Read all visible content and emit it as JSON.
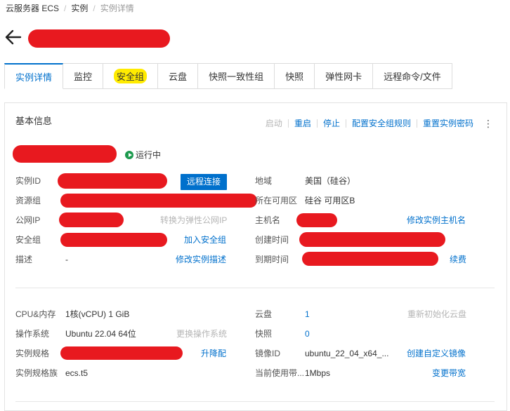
{
  "breadcrumb": {
    "items": [
      "云服务器 ECS",
      "实例",
      "实例详情"
    ],
    "separator": "/"
  },
  "tabs": [
    {
      "label": "实例详情",
      "active": true
    },
    {
      "label": "监控"
    },
    {
      "label": "安全组",
      "highlighted": true
    },
    {
      "label": "云盘"
    },
    {
      "label": "快照一致性组"
    },
    {
      "label": "快照"
    },
    {
      "label": "弹性网卡"
    },
    {
      "label": "远程命令/文件"
    }
  ],
  "basic_info": {
    "title": "基本信息",
    "actions": {
      "start": "启动",
      "restart": "重启",
      "stop": "停止",
      "config_sg_rules": "配置安全组规则",
      "reset_password": "重置实例密码",
      "more": "⋮"
    },
    "status": "运行中",
    "remote_connect": "远程连接",
    "fields": {
      "instance_id_label": "实例ID",
      "resource_group_label": "资源组",
      "public_ip_label": "公网IP",
      "convert_eip": "转换为弹性公网IP",
      "security_group_label": "安全组",
      "join_sg": "加入安全组",
      "description_label": "描述",
      "description_value": "-",
      "modify_description": "修改实例描述",
      "region_label": "地域",
      "region_value": "美国（硅谷）",
      "zone_label": "所在可用区",
      "zone_value": "硅谷 可用区B",
      "hostname_label": "主机名",
      "modify_hostname": "修改实例主机名",
      "created_label": "创建时间",
      "expires_label": "到期时间",
      "renew": "续费"
    }
  },
  "config": {
    "cpu_mem_label": "CPU&内存",
    "cpu_mem_value": "1核(vCPU) 1 GiB",
    "os_label": "操作系统",
    "os_value": "Ubuntu  22.04 64位",
    "change_os": "更换操作系统",
    "spec_label": "实例规格",
    "upgrade": "升降配",
    "family_label": "实例规格族",
    "family_value": "ecs.t5",
    "disk_label": "云盘",
    "disk_value": "1",
    "reinit_disk": "重新初始化云盘",
    "snapshot_label": "快照",
    "snapshot_value": "0",
    "image_label": "镜像ID",
    "image_value": "ubuntu_22_04_x64_...",
    "create_image": "创建自定义镜像",
    "bandwidth_label": "当前使用带...",
    "bandwidth_value": "1Mbps",
    "change_bandwidth": "变更带宽"
  },
  "colors": {
    "accent": "#0070cc",
    "redaction": "#e8191f",
    "status_green": "#1d9a4e",
    "highlight": "#ffeb00"
  }
}
